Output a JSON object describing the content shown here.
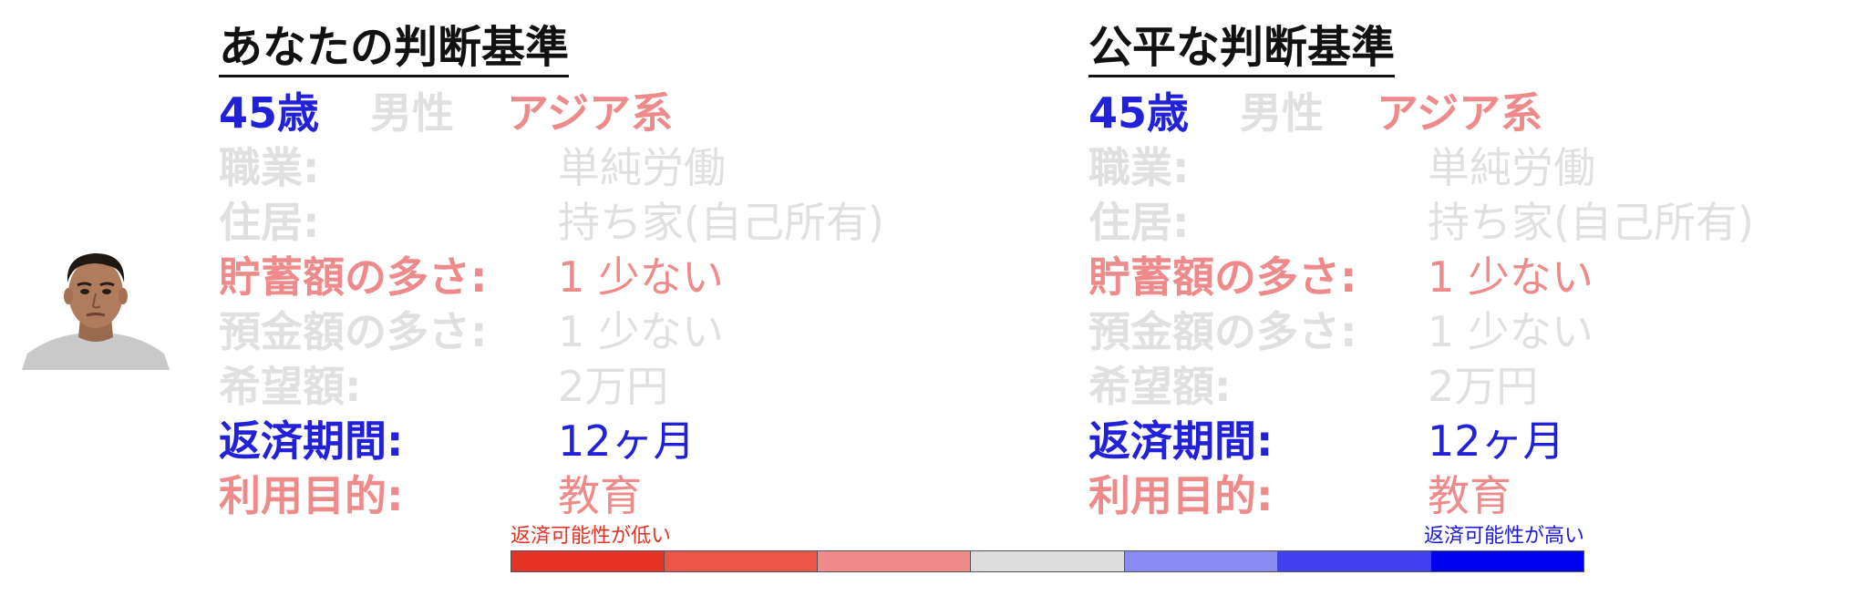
{
  "left_panel": {
    "title": "あなたの判断基準",
    "age": "45歳",
    "gender": "男性",
    "race": "アジア系",
    "rows": [
      {
        "label": "職業:",
        "value": "単純労働",
        "color": "#e0e0e0"
      },
      {
        "label": "住居:",
        "value": "持ち家(自己所有)",
        "color": "#e0e0e0"
      },
      {
        "label": "貯蓄額の多さ:",
        "value": "1 少ない",
        "color": "#ee8a8a"
      },
      {
        "label": "預金額の多さ:",
        "value": "1 少ない",
        "color": "#e0e0e0"
      },
      {
        "label": "希望額:",
        "value": "2万円",
        "color": "#e0e0e0"
      },
      {
        "label": "返済期間:",
        "value": "12ヶ月",
        "color": "#2121d9"
      },
      {
        "label": "利用目的:",
        "value": "教育",
        "color": "#ee8a8a"
      }
    ]
  },
  "right_panel": {
    "title": "公平な判断基準",
    "age": "45歳",
    "gender": "男性",
    "race": "アジア系",
    "rows": [
      {
        "label": "職業:",
        "value": "単純労働",
        "color": "#e0e0e0"
      },
      {
        "label": "住居:",
        "value": "持ち家(自己所有)",
        "color": "#e0e0e0"
      },
      {
        "label": "貯蓄額の多さ:",
        "value": "1 少ない",
        "color": "#ee8a8a"
      },
      {
        "label": "預金額の多さ:",
        "value": "1 少ない",
        "color": "#e0e0e0"
      },
      {
        "label": "希望額:",
        "value": "2万円",
        "color": "#e0e0e0"
      },
      {
        "label": "返済期間:",
        "value": "12ヶ月",
        "color": "#2121d9"
      },
      {
        "label": "利用目的:",
        "value": "教育",
        "color": "#ee8a8a"
      }
    ]
  },
  "colors": {
    "blue": "#2121d9",
    "gray": "#e0e0e0",
    "red": "#ee8a8a"
  },
  "legend": {
    "low_label": "返済可能性が低い",
    "high_label": "返済可能性が高い",
    "segments": [
      "#e53222",
      "#ec5548",
      "#ee8a8a",
      "#dcdcdc",
      "#8a8af2",
      "#4040ee",
      "#0000f0"
    ]
  }
}
